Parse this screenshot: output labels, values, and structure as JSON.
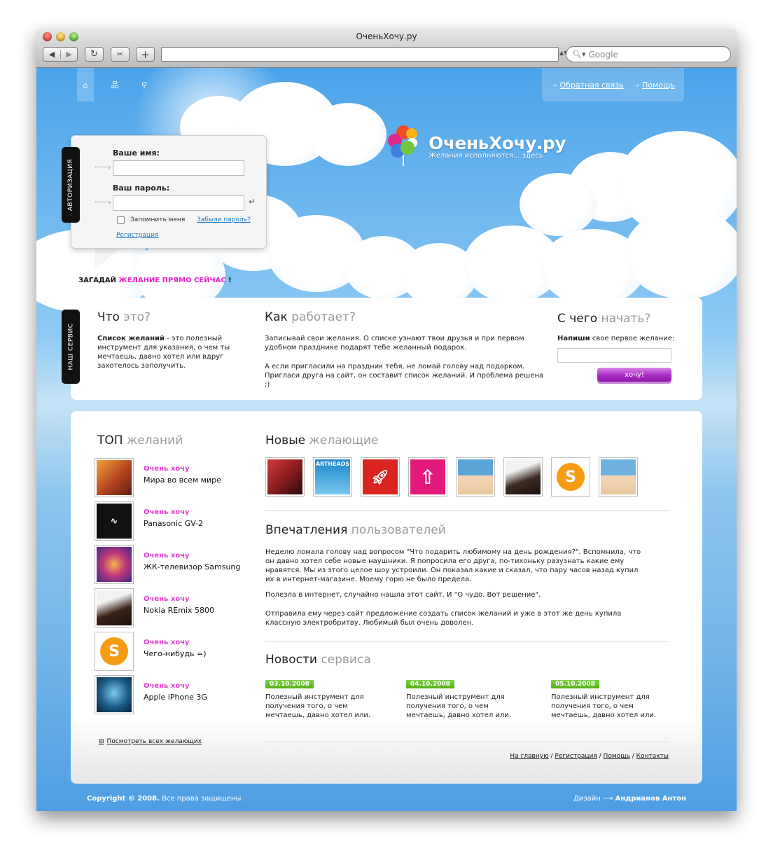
{
  "window": {
    "title": "ОченьХочу.ру"
  },
  "toolbar": {
    "back_glyph": "◀",
    "forward_glyph": "▶",
    "reload_glyph": "↻",
    "snip_glyph": "✂",
    "add_glyph": "+",
    "url_value": "",
    "search_placeholder": "Google"
  },
  "header": {
    "nav_icons": [
      "home-icon",
      "sitemap-icon",
      "search-icon"
    ],
    "links": [
      {
        "label": "Обратная связь"
      },
      {
        "label": "Помощь"
      }
    ]
  },
  "logo": {
    "title": "ОченьХочу.ру",
    "tagline": "Желания исполняются... здесь"
  },
  "login": {
    "tab_label": "АВТОРИЗАЦИЯ",
    "name_label": "Ваше имя:",
    "name_value": "",
    "password_label": "Ваш пароль:",
    "password_value": "",
    "remember_label": "Запомнить меня",
    "forgot_label": "Забыли пароль?",
    "register_label": "Регистрация"
  },
  "tagline": {
    "prefix": "ЗАГАДАЙ ",
    "highlight": "ЖЕЛАНИЕ ПРЯМО СЕЙЧАС",
    "suffix": " !"
  },
  "service": {
    "tab_label": "НАШ СЕРВИС",
    "col1": {
      "title_dark": "Что",
      "title_light": "это?",
      "bold": "Список желаний",
      "text": " - это полезный инструмент для указания, о чем ты мечтаешь, давно хотел или вдруг захотелось заполучить."
    },
    "col2": {
      "title_dark": "Как",
      "title_light": "работает?",
      "p1": "Записывай свои желания. О списке узнают твои друзья и при первом удобном празднике подарят тебе желанный подарок.",
      "p2": "А если пригласили на праздник тебя, не ломай голову над подарком. Пригласи друга на сайт, он составит список желаний. И проблема решена ;)"
    },
    "col3": {
      "title_dark": "С чего",
      "title_light": "начать?",
      "bold": "Напиши",
      "text": " свое первое желание:",
      "input_value": "",
      "button_label": "хочу!"
    }
  },
  "top_wishes": {
    "title_dark": "ТОП",
    "title_light": "желаний",
    "items": [
      {
        "action": "Очень хочу",
        "name": "Мира во всем мире",
        "color": "#b4431f"
      },
      {
        "action": "Очень хочу",
        "name": "Panasonic GV-2",
        "color": "#111111"
      },
      {
        "action": "Очень хочу",
        "name": "ЖК-телевизор Samsung",
        "color": "#6a3ab0"
      },
      {
        "action": "Очень хочу",
        "name": "Nokia REmix 5800",
        "color": "#3a2218"
      },
      {
        "action": "Очень хочу",
        "name": "Чего-нибудь =)",
        "color": "#f59c12"
      },
      {
        "action": "Очень хочу",
        "name": "Apple iPhone 3G",
        "color": "#1b5c86"
      }
    ],
    "all_link": "Посмотреть всех желающих"
  },
  "new_users": {
    "title_dark": "Новые",
    "title_light": "желающие",
    "avatars": [
      {
        "color": "#8c1d1d",
        "text": ""
      },
      {
        "color": "#1a86c9",
        "text": "ARTHEADS"
      },
      {
        "color": "#d92420",
        "text": ""
      },
      {
        "color": "#e21a7a",
        "text": ""
      },
      {
        "color": "#5aa4d6",
        "text": ""
      },
      {
        "color": "#3b2a22",
        "text": ""
      },
      {
        "color": "#f59c12",
        "text": ""
      },
      {
        "color": "#6fb2df",
        "text": ""
      }
    ]
  },
  "reviews": {
    "title_dark": "Впечатления",
    "title_light": "пользователей",
    "p1": "Неделю ломала голову над вопросом \"Что подарить любимому на день рождения?\". Вспомнила, что он давно хотел себе новые наушники. Я попросила его друга, по-тихоньку разузнать какие ему нравятся. Мы из этого целое шоу устроили. Он показал какие и сказал, что пару часов назад купил их в интернет-магазине. Моему горю не было предела.",
    "p2": "Полезла в интернет, случайно нашла этот сайт. И \"О чудо. Вот решение\".",
    "p3": "Отправила ему через сайт предложение создать список желаний и уже в этот же день купила классную электробритву. Любимый был очень доволен."
  },
  "news": {
    "title_dark": "Новости",
    "title_light": "сервиса",
    "items": [
      {
        "date": "03.10.2008",
        "text": "Полезный инструмент для получения того, о чем мечтаешь, давно хотел или."
      },
      {
        "date": "04.10.2008",
        "text": "Полезный инструмент для получения того, о чем мечтаешь, давно хотел или."
      },
      {
        "date": "05.10.2008",
        "text": "Полезный инструмент для получения того, о чем мечтаешь, давно хотел или."
      }
    ]
  },
  "footer": {
    "links": [
      "На главную",
      "Регистрация",
      "Помощь",
      "Контакты"
    ],
    "separator": " / ",
    "copyright_bold": "Copyright © 2008.",
    "copyright_text": " Все права защищены",
    "design_label": "Дизайн",
    "design_arrow": "⟶",
    "designer": "Андрианов Антон"
  }
}
